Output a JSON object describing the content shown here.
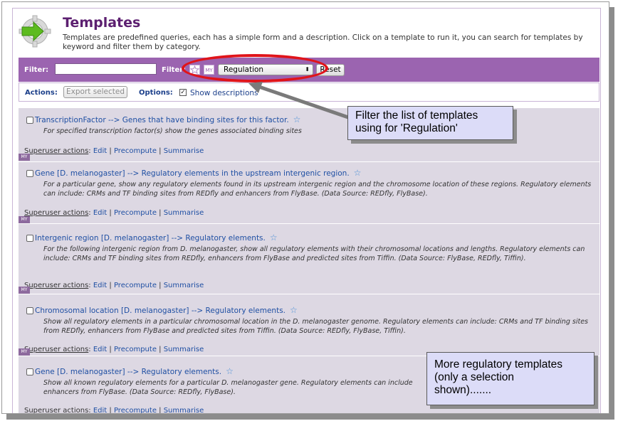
{
  "header": {
    "title": "Templates",
    "intro": "Templates are predefined queries, each has a simple form and a description. Click on a template to run it, you can search for templates by keyword and filter them by category."
  },
  "filter_bar": {
    "filter_label": "Filter:",
    "filter_text_value": "",
    "filter2_label": "Filter:",
    "tag_star_text": "",
    "tag_my_text": "MY",
    "category_selected": "Regulation",
    "reset_label": "Reset"
  },
  "actions_bar": {
    "actions_label": "Actions:",
    "export_label": "Export selected",
    "options_label": "Options:",
    "show_descriptions_label": "Show descriptions",
    "show_descriptions_checked": true
  },
  "templates": [
    {
      "title": "TranscriptionFactor --> Genes that have binding sites for this factor.",
      "description": "For specified transcription factor(s) show the genes associated binding sites",
      "su_label": "Superuser actions",
      "su_edit": "Edit",
      "su_precompute": "Precompute",
      "su_summarise": "Summarise",
      "tag": "MY"
    },
    {
      "title": "Gene [D. melanogaster] --> Regulatory elements in the upstream intergenic region.",
      "description": "For a particular gene, show any regulatory elements found in its upstream intergenic region and the chromosome location of these regions. Regulatory elements can include: CRMs and TF binding sites from REDfly and enhancers from FlyBase. (Data Source: REDfly, FlyBase).",
      "su_label": "Superuser actions",
      "su_edit": "Edit",
      "su_precompute": "Precompute",
      "su_summarise": "Summarise",
      "tag": "MY"
    },
    {
      "title": "Intergenic region [D. melanogaster] --> Regulatory elements.",
      "description": "For the following intergenic region from D. melanogaster, show all regulatory elements with their chromosomal locations and lengths. Regulatory elements can include: CRMs and TF binding sites from REDfly, enhancers from FlyBase and predicted sites from Tiffin. (Data Source: FlyBase, REDfly, Tiffin).",
      "su_label": "Superuser actions",
      "su_edit": "Edit",
      "su_precompute": "Precompute",
      "su_summarise": "Summarise",
      "tag": "MY"
    },
    {
      "title": "Chromosomal location [D. melanogaster] --> Regulatory elements.",
      "description": "Show all regulatory elements in a particular chromosomal location in the D. melanogaster genome. Regulatory elements can include: CRMs and TF binding sites from REDfly, enhancers from FlyBase and predicted sites from Tiffin. (Data Source: REDfly, FlyBase, Tiffin).",
      "su_label": "Superuser actions",
      "su_edit": "Edit",
      "su_precompute": "Precompute",
      "su_summarise": "Summarise",
      "tag": "MY"
    },
    {
      "title": "Gene [D. melanogaster] --> Regulatory elements.",
      "description": "Show all known regulatory elements for a particular D. melanogaster gene. Regulatory elements can include",
      "description_line2": "enhancers from FlyBase. (Data Source: REDfly, FlyBase).",
      "su_label": "Superuser actions",
      "su_edit": "Edit",
      "su_precompute": "Precompute",
      "su_summarise": "Summarise"
    }
  ],
  "callouts": {
    "filter_note_line1": "Filter the list of templates",
    "filter_note_line2": "using for 'Regulation'",
    "more_note_line1": "More regulatory templates",
    "more_note_line2": "(only a selection",
    "more_note_line3": "shown)......."
  },
  "colors": {
    "title": "#5c1f70",
    "filter_bar": "#9b64b0",
    "list_bg": "#ddd8e3",
    "link": "#1f4fa3",
    "highlight": "#e0141a",
    "callout_bg": "#dcdcf8"
  },
  "icons": {
    "logo": "templates-logo-icon",
    "star": "favourite-star-icon",
    "arrow": "pointer-arrow-icon"
  }
}
